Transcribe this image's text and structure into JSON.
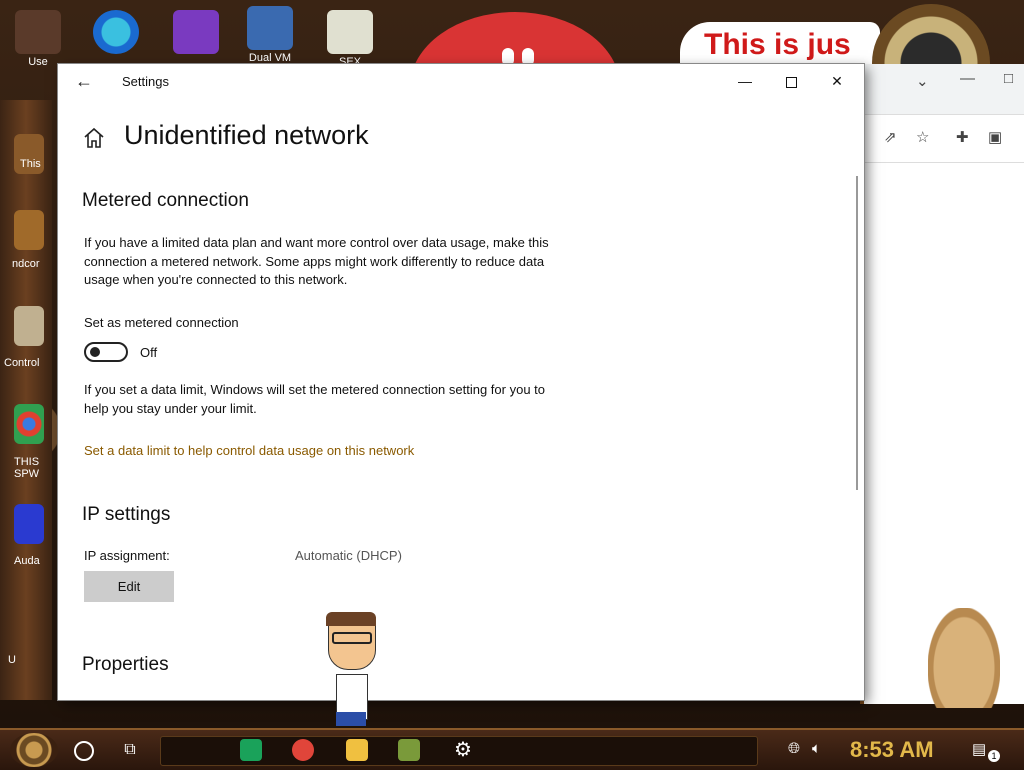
{
  "desktop": {
    "banner_text": "This is jus",
    "top_icons": [
      {
        "label": "Use",
        "icon": "user-icon"
      },
      {
        "label": "",
        "icon": "edge-icon"
      },
      {
        "label": "",
        "icon": "visual-studio-icon"
      },
      {
        "label": "Dual VM",
        "icon": "virtualbox-icon"
      },
      {
        "label": "SEX EDITOR",
        "icon": "hex-editor-icon"
      }
    ],
    "left_labels": [
      "This",
      "ndcor",
      "Control",
      "THIS SPW",
      "Auda",
      "U"
    ]
  },
  "settings": {
    "window_title": "Settings",
    "page_title": "Unidentified network",
    "metered": {
      "heading": "Metered connection",
      "description": "If you have a limited data plan and want more control over data usage, make this connection a metered network. Some apps might work differently to reduce data usage when you're connected to this network.",
      "toggle_label": "Set as metered connection",
      "toggle_state": "Off",
      "toggle_on": false,
      "limit_note": "If you set a data limit, Windows will set the metered connection setting for you to help you stay under your limit.",
      "limit_link": "Set a data limit to help control data usage on this network"
    },
    "ip": {
      "heading": "IP settings",
      "assignment_label": "IP assignment:",
      "assignment_value": "Automatic (DHCP)",
      "edit_label": "Edit"
    },
    "properties": {
      "heading": "Properties"
    }
  },
  "taskbar": {
    "clock": "8:53 AM",
    "notification_count": "1",
    "pinned": [
      {
        "name": "sheets-icon",
        "color": "#1aa25a"
      },
      {
        "name": "chrome-icon",
        "color": "#e0453a"
      },
      {
        "name": "file-explorer-icon",
        "color": "#f0c040"
      },
      {
        "name": "game-icon",
        "color": "#7a9a3a"
      },
      {
        "name": "settings-gear-icon",
        "color": "#ffffff"
      }
    ]
  }
}
